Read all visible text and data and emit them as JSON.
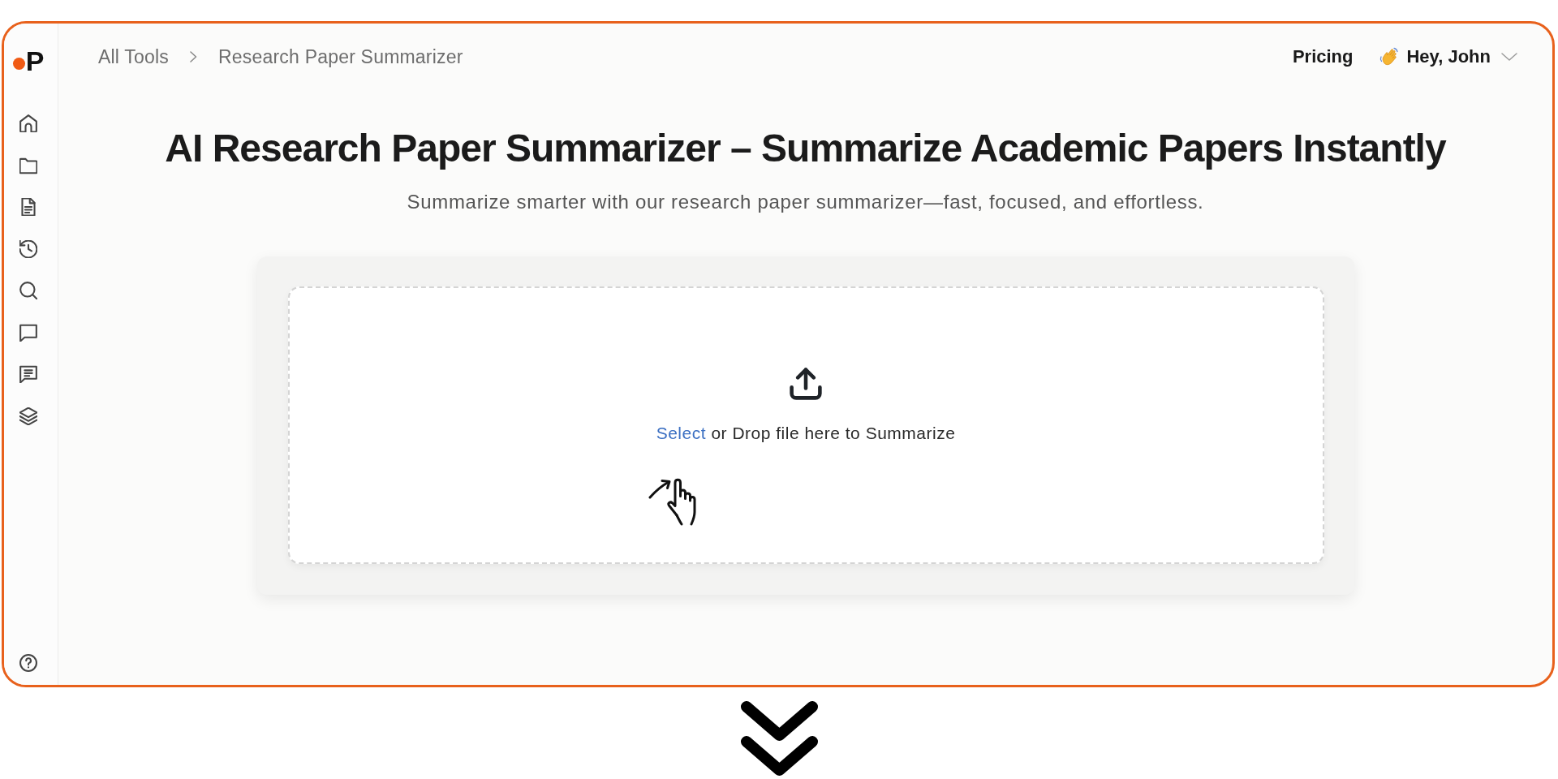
{
  "brand": {
    "letter": "P"
  },
  "breadcrumb": {
    "items": [
      "All Tools",
      "Research Paper Summarizer"
    ]
  },
  "header": {
    "links": [
      "Pricing"
    ],
    "user_menu": {
      "greeting": "Hey, John"
    }
  },
  "hero": {
    "title": "AI Research Paper Summarizer – Summarize Academic Papers Instantly",
    "subtitle": "Summarize smarter with our research paper summarizer—fast, focused, and effortless."
  },
  "upload": {
    "link": "Select",
    "text": "or Drop file here to Summarize"
  }
}
